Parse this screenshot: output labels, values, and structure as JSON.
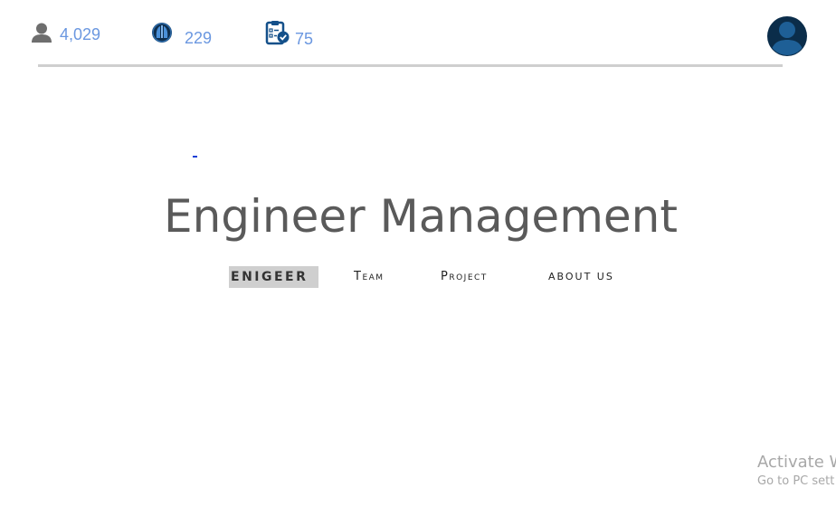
{
  "stats": {
    "users": {
      "value": "4,029",
      "icon": "user-icon"
    },
    "engineers": {
      "value": "229",
      "icon": "engineer-icon"
    },
    "projects": {
      "value": "75",
      "icon": "clipboard-check-icon"
    }
  },
  "header": {
    "avatar_icon": "profile-avatar-icon"
  },
  "main": {
    "title": "Engineer Management"
  },
  "nav": {
    "items": [
      {
        "label": "Enigeer",
        "active": true
      },
      {
        "label": "Team",
        "active": false
      },
      {
        "label": "Project",
        "active": false
      },
      {
        "label": "about us",
        "active": false
      }
    ]
  },
  "watermark": {
    "line1": "Activate W",
    "line2": "Go to PC sett"
  },
  "colors": {
    "stat_number": "#6a97e0",
    "avatar_bg": "#0b2d4a",
    "avatar_fg": "#1e5f96",
    "divider": "#cfcfcf",
    "title_text": "#5a5a5a",
    "active_tab_bg": "#cfcfcf"
  }
}
